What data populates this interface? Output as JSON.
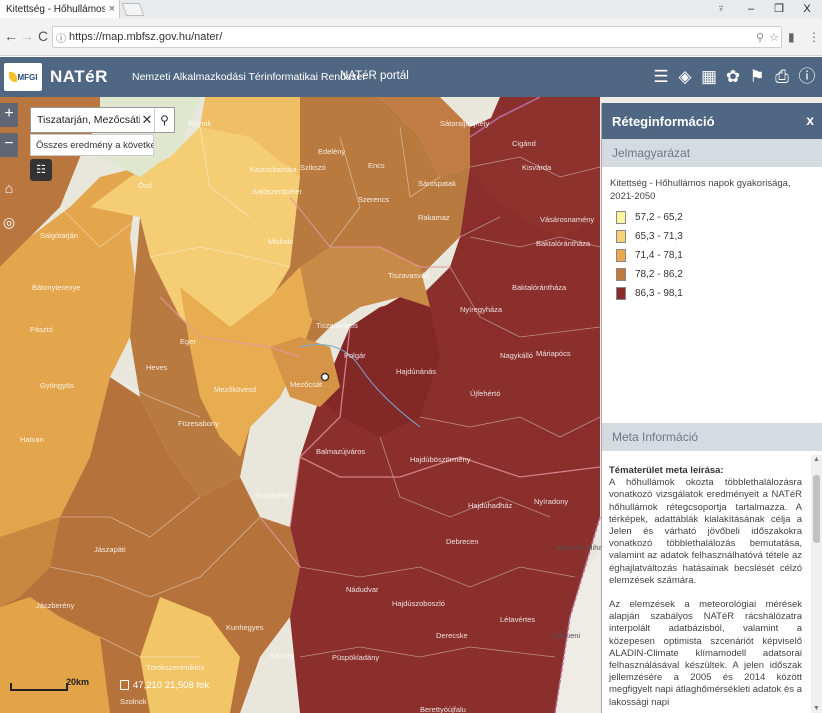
{
  "browser": {
    "tab_title": "Kitettség - Hőhullámos n",
    "tab_close": "×",
    "url": "https://map.mbfsz.gov.hu/nater/",
    "window_controls": [
      "⍤",
      "–",
      "❐",
      "X"
    ]
  },
  "header": {
    "logo_text": "MFGI",
    "title": "NATéR",
    "subtitle": "Nemzeti Alkalmazkodási Térinformatikai Rendszer",
    "portal_link": "NATéR portál",
    "icons": [
      "list-icon",
      "layers-icon",
      "grid-icon",
      "globe-icon",
      "bookmark-icon",
      "print-icon",
      "info-icon"
    ]
  },
  "map": {
    "zoom_in": "+",
    "zoom_out": "−",
    "search_value": "Tiszatarján, Mezőcsáti Járá",
    "search_hint": "Összes eredmény a követke...",
    "scale_label": "20km",
    "coords": "47,210  21,508 fok",
    "places": [
      "Putnok",
      "Ózd",
      "Kazincbarcika",
      "Edelény",
      "Sátoraljaújhely",
      "Cigánd",
      "Szikszó",
      "Encs",
      "Szerencs",
      "Sárospatak",
      "Kisvárda",
      "Salgótarján",
      "Bátonyterenye",
      "Miskolc",
      "Sajószentpéter",
      "Rakamaz",
      "Nyíregyháza",
      "Eger",
      "Mezőkövesd",
      "Tiszaújváros",
      "Tiszavasvári",
      "Baktalórántháza",
      "Pásztó",
      "Gyöngyös",
      "Hatvan",
      "Heves",
      "Füzesabony",
      "Mezőcsát",
      "Polgár",
      "Hajdúnánás",
      "Újfehértó",
      "Nagykálló",
      "Máriapócs",
      "Tiszafüred",
      "Balmazújváros",
      "Hajdúböszörmény",
      "Hajdúhadház",
      "Nyíradony",
      "Debrecen",
      "Hajdúszoboszló",
      "Derecske",
      "Létavértes",
      "Nádudvar",
      "Püspökladány",
      "Berettyóújfalu",
      "Jászberény",
      "Jászapáti",
      "Kunhegyes",
      "Karcag",
      "Törökszentmiklós",
      "Szolnok",
      "Vásárosnamény",
      "Baktalórántháza",
      "Valea lui Mihai",
      "Săcueni"
    ]
  },
  "panel": {
    "title": "Réteginformáció",
    "close": "x",
    "legend_header": "Jelmagyarázat",
    "legend_title": "Kitettség - Hőhullámos napok gyakorisága, 2021-2050",
    "legend_items": [
      {
        "label": "57,2 - 65,2",
        "color": "#fff3a0"
      },
      {
        "label": "65,3 - 71,3",
        "color": "#f6d279"
      },
      {
        "label": "71,4 - 78,1",
        "color": "#e9aa4e"
      },
      {
        "label": "78,2 - 86,2",
        "color": "#c07a3f"
      },
      {
        "label": "86,3 - 98,1",
        "color": "#8a2c2a"
      }
    ],
    "meta_header": "Meta Információ",
    "meta_heading": "Tématerület meta leírása:",
    "meta_p1": "A hőhullámok okozta többlethalálozásra vonatkozó vizsgálatok eredményeit a NATéR hőhullámok rétegcsoportja tartalmazza. A térképek, adattáblák kialakításának célja a Jelen és várható jövőbeli időszakokra vonatkozó többlethalálozás bemutatása, valamint az adatok felhasználhatóvá tétele az éghajlatváltozás hatásainak becslését célzó elemzések számára.",
    "meta_p2": "Az elemzések a meteorológiai mérések alapján szabályos NATéR rácshálózatra interpolált adatbázisból, valamint a közepesen optimista szcenáriót képviselő ALADIN-Climate klímamodell adatsorai felhasználásával készültek. A jelen időszak jellemzésére a 2005 és 2014 között megfigyelt napi átlaghőmérsékleti adatok és a lakossági napi"
  }
}
